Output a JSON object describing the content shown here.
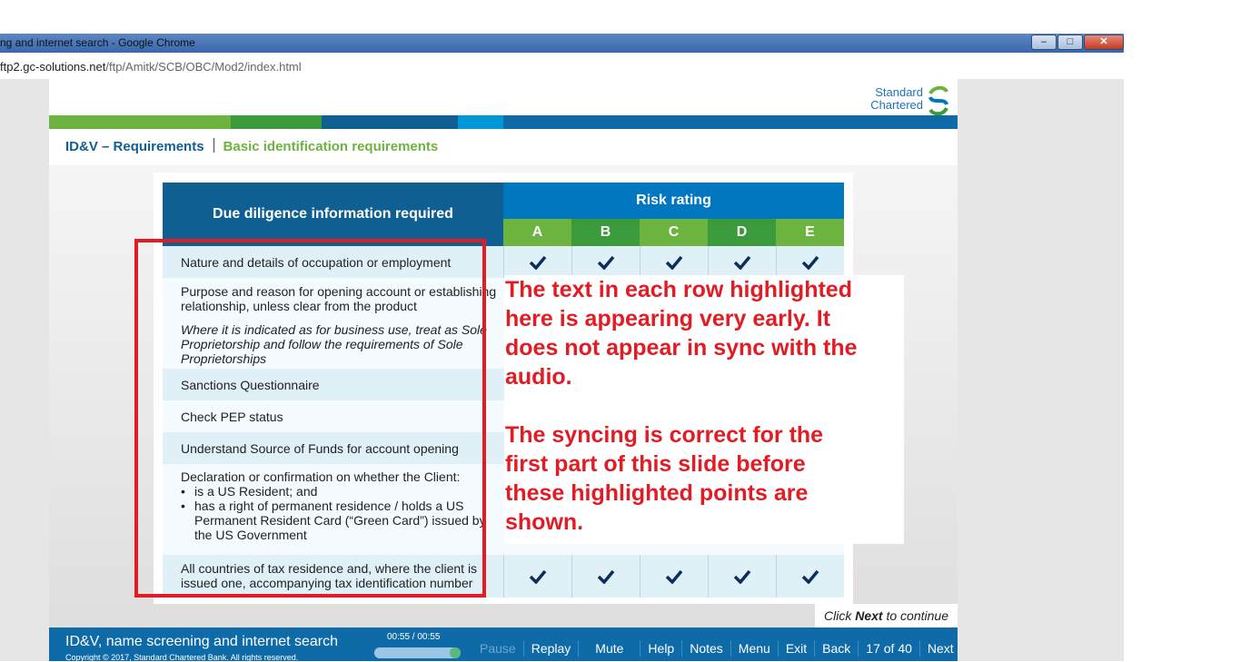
{
  "window": {
    "title": "ng and internet search - Google Chrome",
    "buttons": [
      "–",
      "□",
      "✕"
    ]
  },
  "address": {
    "host": "ftp2.gc-solutions.net",
    "path": "/ftp/Amitk/SCB/OBC/Mod2/index.html"
  },
  "brand": {
    "line1": "Standard",
    "line2": "Chartered",
    "colors": {
      "green": "#6cb33f",
      "darkgreen": "#3a9a3c",
      "navy": "#0f5f93",
      "blue": "#0077c0",
      "lightblue": "#0097d7",
      "red": "#e11c24"
    }
  },
  "breadcrumb": {
    "section": "ID&V – Requirements",
    "page": "Basic identification requirements"
  },
  "table": {
    "left_header": "Due diligence information required",
    "risk_header": "Risk rating",
    "ratings": [
      "A",
      "B",
      "C",
      "D",
      "E"
    ],
    "rows": [
      {
        "lines": [
          "Nature and details of occupation or employment"
        ],
        "checks": [
          true,
          true,
          true,
          true,
          true
        ]
      },
      {
        "lines": [
          "Purpose and reason for opening account or establishing",
          "relationship, unless clear from the product"
        ],
        "note_lines": [
          "Where it is indicated as for business use, treat as Sole",
          "Proprietorship and follow the requirements of Sole",
          "Proprietorships"
        ]
      },
      {
        "lines": [
          "Sanctions Questionnaire"
        ]
      },
      {
        "lines": [
          "Check PEP status"
        ]
      },
      {
        "lines": [
          "Understand Source of Funds for account opening"
        ]
      },
      {
        "lines": [
          "Declaration or confirmation on whether the Client:"
        ],
        "bullets": [
          "is a US Resident; and",
          "has a right of permanent residence / holds a US",
          "Permanent Resident Card (“Green Card”) issued by",
          "the US Government"
        ]
      },
      {
        "lines": [
          "All countries of tax residence and, where the client is",
          "issued one, accompanying tax identification number"
        ],
        "checks": [
          true,
          true,
          true,
          true,
          true
        ]
      }
    ]
  },
  "annotation": {
    "para1": [
      "The text in each row highlighted",
      "here is appearing very early. It",
      "does not appear in sync with the",
      "audio."
    ],
    "para2": [
      "The syncing is correct for the",
      "first part of this slide before",
      "these highlighted points are",
      "shown."
    ]
  },
  "prompt": {
    "pre": "Click",
    "bold": "Next",
    "post": "to continue"
  },
  "footer": {
    "title": "ID&V, name screening and internet search",
    "copyright": "Copyright © 2017, Standard Chartered Bank. All rights reserved.",
    "time": "00:55 / 00:55",
    "progress": 1.0,
    "nav": {
      "pause": "Pause",
      "replay": "Replay",
      "mute": "Mute",
      "help": "Help",
      "notes": "Notes",
      "menu": "Menu",
      "exit": "Exit",
      "back": "Back",
      "page": "17 of 40",
      "next": "Next"
    }
  }
}
